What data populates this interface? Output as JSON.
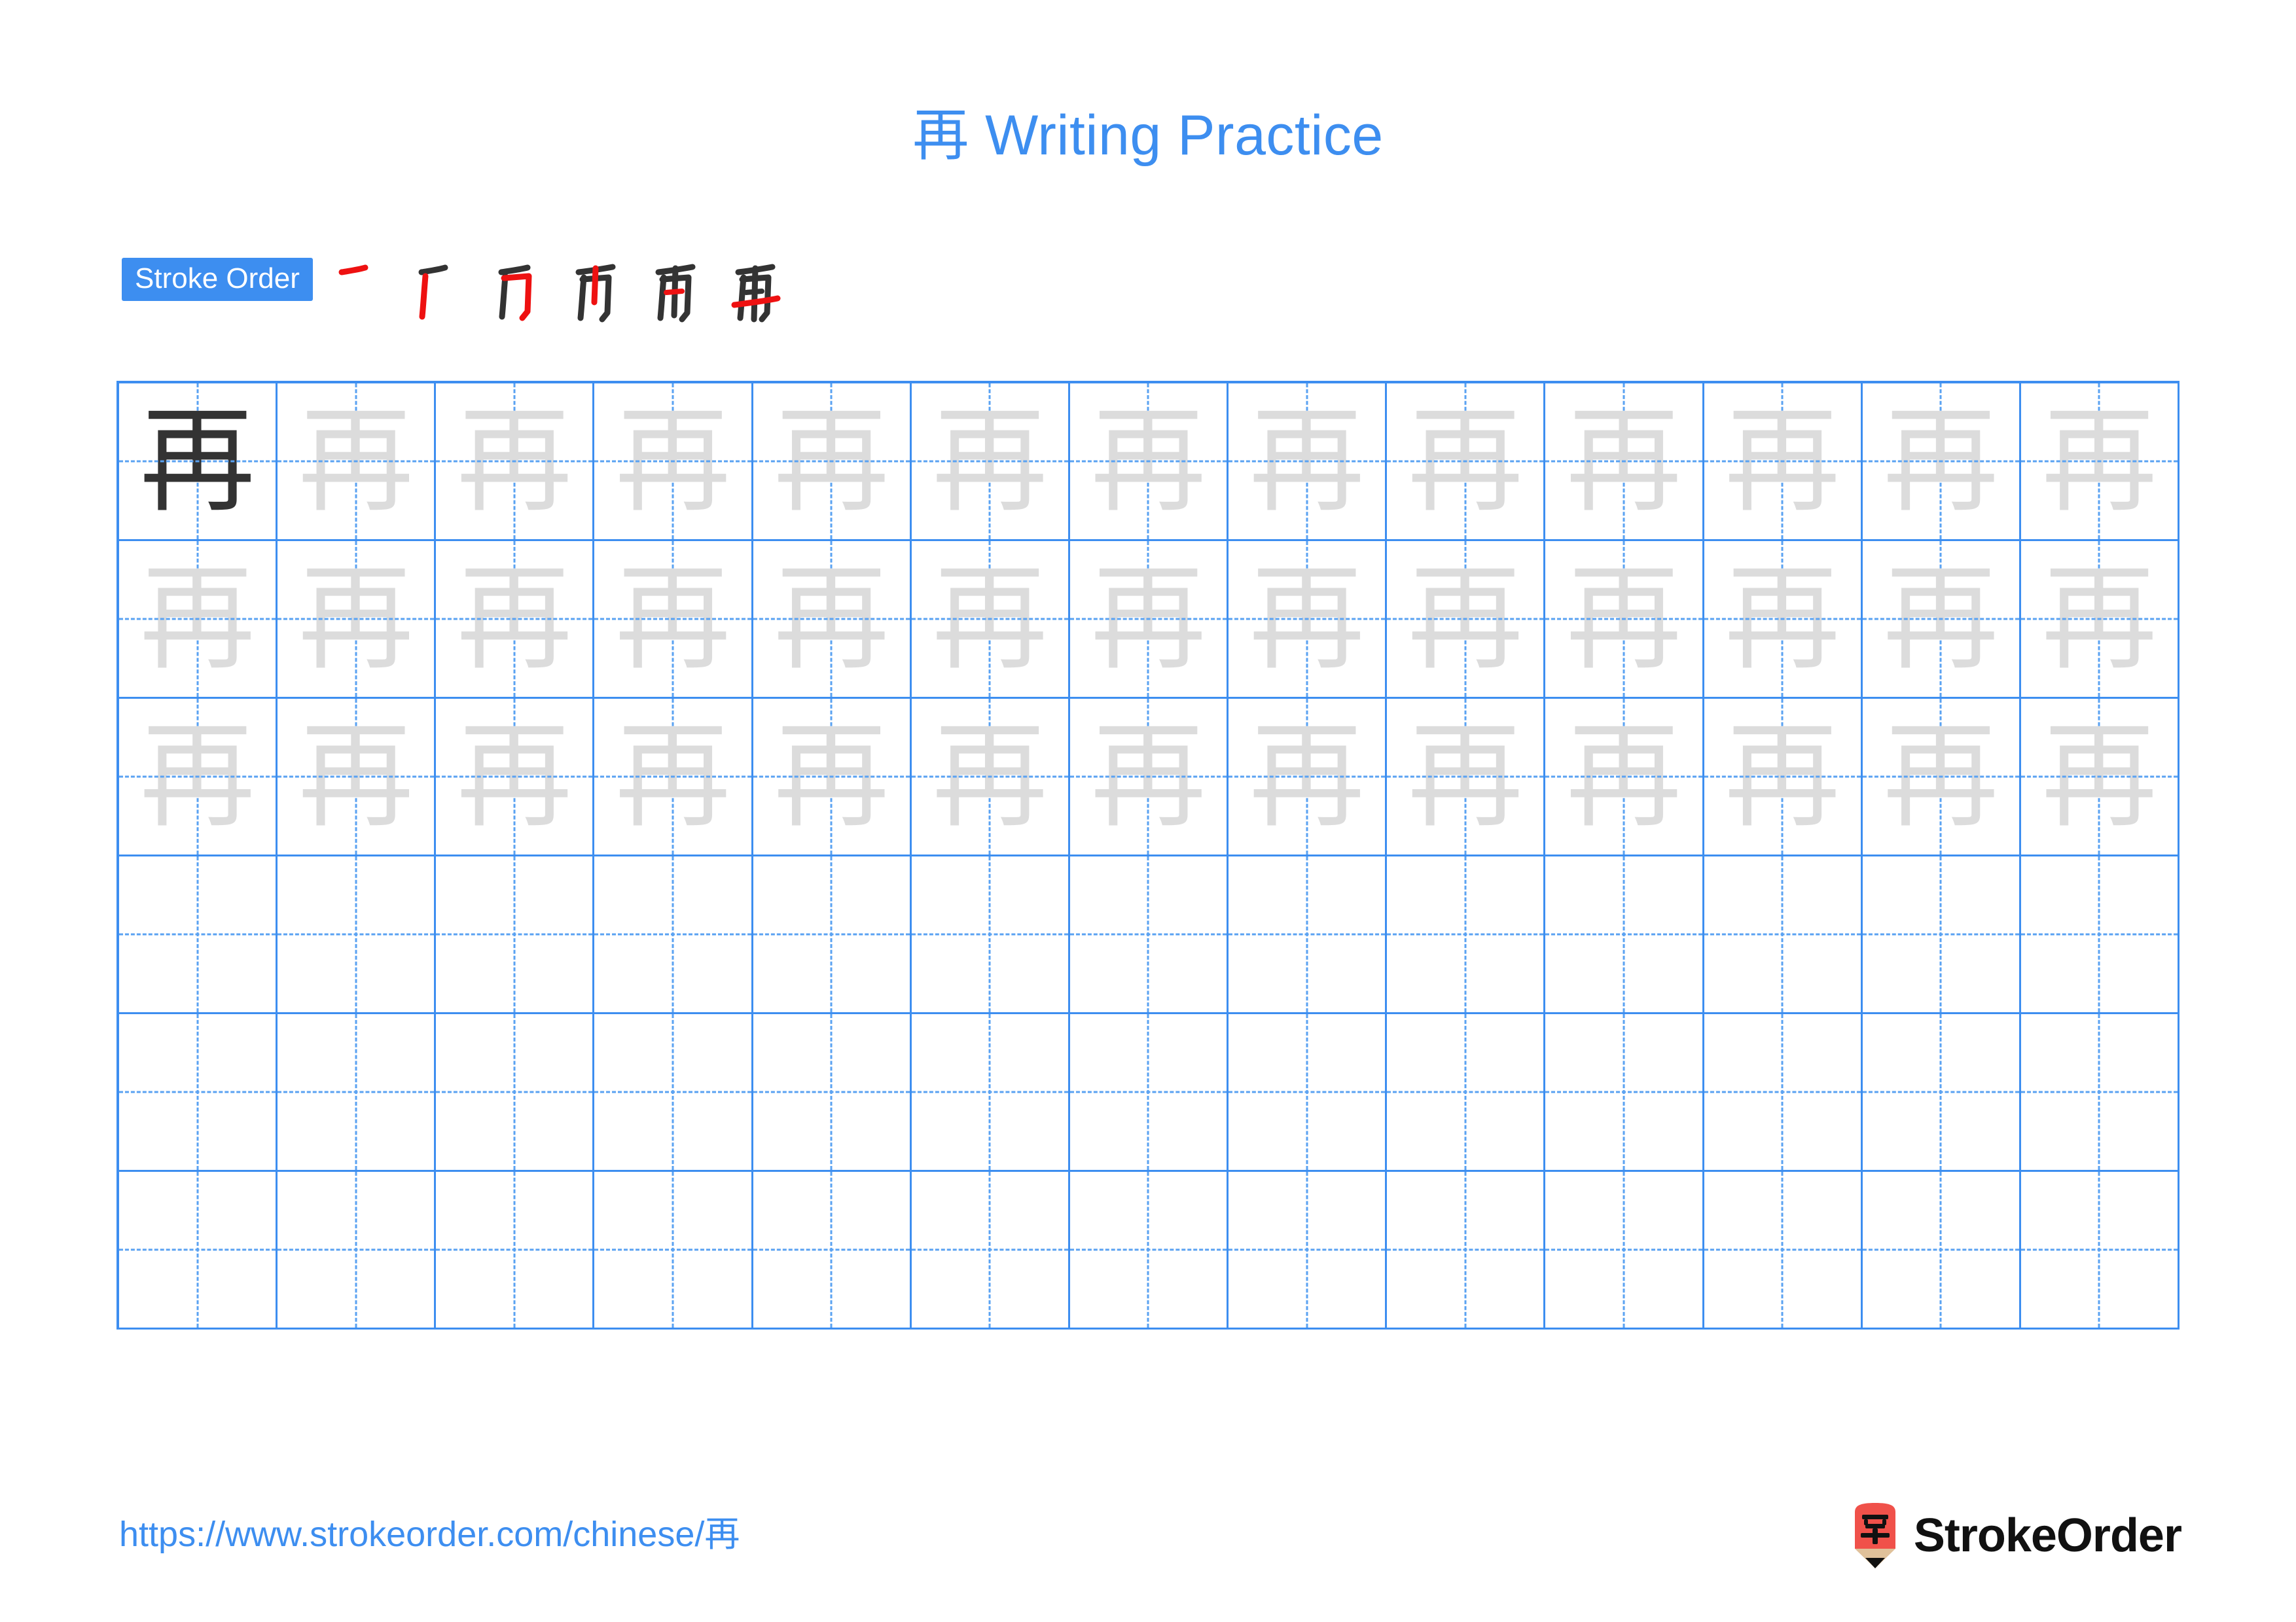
{
  "page": {
    "title_character": "再",
    "title_suffix": " Writing Practice",
    "title_full": "再 Writing Practice",
    "accent_color": "#3d8ef0",
    "model_char_color": "#333333",
    "trace_char_color": "#dcdcdc",
    "new_stroke_color": "#ee1111",
    "drawn_stroke_color": "#333333"
  },
  "stroke_order": {
    "badge_label": "Stroke Order",
    "total_strokes": 6,
    "steps": [
      {
        "index": 1,
        "new_stroke_name": "heng",
        "cumulative_strokes": 1
      },
      {
        "index": 2,
        "new_stroke_name": "pie",
        "cumulative_strokes": 2
      },
      {
        "index": 3,
        "new_stroke_name": "heng-zhe-gou",
        "cumulative_strokes": 3
      },
      {
        "index": 4,
        "new_stroke_name": "shu",
        "cumulative_strokes": 4
      },
      {
        "index": 5,
        "new_stroke_name": "heng",
        "cumulative_strokes": 5
      },
      {
        "index": 6,
        "new_stroke_name": "heng",
        "cumulative_strokes": 6
      }
    ]
  },
  "grid": {
    "columns": 13,
    "rows": 6,
    "practice_character": "再",
    "cells": [
      [
        "model",
        "trace",
        "trace",
        "trace",
        "trace",
        "trace",
        "trace",
        "trace",
        "trace",
        "trace",
        "trace",
        "trace",
        "trace"
      ],
      [
        "trace",
        "trace",
        "trace",
        "trace",
        "trace",
        "trace",
        "trace",
        "trace",
        "trace",
        "trace",
        "trace",
        "trace",
        "trace"
      ],
      [
        "trace",
        "trace",
        "trace",
        "trace",
        "trace",
        "trace",
        "trace",
        "trace",
        "trace",
        "trace",
        "trace",
        "trace",
        "trace"
      ],
      [
        "empty",
        "empty",
        "empty",
        "empty",
        "empty",
        "empty",
        "empty",
        "empty",
        "empty",
        "empty",
        "empty",
        "empty",
        "empty"
      ],
      [
        "empty",
        "empty",
        "empty",
        "empty",
        "empty",
        "empty",
        "empty",
        "empty",
        "empty",
        "empty",
        "empty",
        "empty",
        "empty"
      ],
      [
        "empty",
        "empty",
        "empty",
        "empty",
        "empty",
        "empty",
        "empty",
        "empty",
        "empty",
        "empty",
        "empty",
        "empty",
        "empty"
      ]
    ]
  },
  "footer": {
    "url_prefix": "https://www.strokeorder.com/chinese/",
    "url_character": "再",
    "url_full": "https://www.strokeorder.com/chinese/再",
    "brand_name": "StrokeOrder",
    "logo_character": "字",
    "logo_body_color": "#f0514a",
    "logo_wood_color": "#e0c19a",
    "logo_tip_color": "#111111"
  }
}
